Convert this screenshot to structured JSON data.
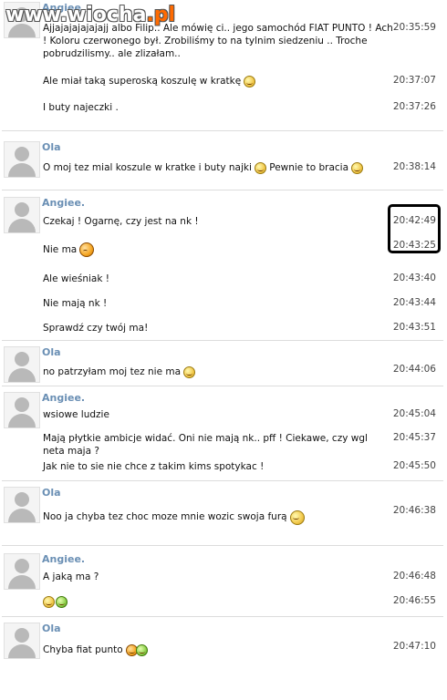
{
  "watermark": {
    "main": "www.wiocha",
    "suffix": ".pl"
  },
  "blocks": [
    {
      "sender": "Angiee.",
      "messages": [
        {
          "text": "Ajjajajajajajajj albo Filip.. Ale mówię ci.. jego samochód FIAT PUNTO ! Ach ! Koloru czerwonego był. Zrobiliśmy to na tylnim siedzeniu .. Troche pobrudzilismy.. ale zlizałam..",
          "time": "20:35:59"
        },
        {
          "text": "Ale miał taką superoską koszulę w kratkę",
          "time": "20:37:07",
          "emoticon": "big-grin-icon"
        },
        {
          "text": "I buty najeczki .",
          "time": "20:37:26"
        }
      ]
    },
    {
      "sender": "Ola",
      "messages": [
        {
          "text": "O moj tez mial koszule w kratke i buty najki",
          "text2": "Pewnie to bracia",
          "time": "20:38:14",
          "emoticon": "big-grin-icon",
          "emoticon2": "big-grin-icon"
        }
      ]
    },
    {
      "sender": "Angiee.",
      "messages": [
        {
          "text": "Czekaj ! Ogarnę, czy jest na nk !",
          "time": "20:42:49"
        },
        {
          "text": "Nie ma",
          "time": "20:43:25",
          "emoticon": "sad-face-icon"
        },
        {
          "text": "Ale wieśniak !",
          "time": "20:43:40"
        },
        {
          "text": "Nie mają nk !",
          "time": "20:43:44"
        },
        {
          "text": "Sprawdź czy twój ma!",
          "time": "20:43:51"
        }
      ]
    },
    {
      "sender": "Ola",
      "messages": [
        {
          "text": "no patrzyłam moj tez nie ma",
          "time": "20:44:06",
          "emoticon": "big-grin-icon"
        }
      ]
    },
    {
      "sender": "Angiee.",
      "messages": [
        {
          "text": "wsiowe ludzie",
          "time": "20:45:04"
        },
        {
          "text": "Mają płytkie ambicje widać. Oni nie mają nk.. pff ! Ciekawe, czy wgl neta maja ?",
          "time": "20:45:37"
        },
        {
          "text": "Jak nie to sie nie chce z takim kims spotykac !",
          "time": "20:45:50"
        }
      ]
    },
    {
      "sender": "Ola",
      "messages": [
        {
          "text": "Noo ja chyba tez choc moze mnie wozic swoja furą",
          "time": "20:46:38",
          "emoticon": "smile-icon"
        }
      ]
    },
    {
      "sender": "Angiee.",
      "messages": [
        {
          "text": "A jaką ma ?",
          "time": "20:46:48"
        },
        {
          "text": "",
          "time": "20:46:55",
          "emoticon": "grin-icon",
          "emoticon2": "green-face-icon"
        }
      ]
    },
    {
      "sender": "Ola",
      "messages": [
        {
          "text": "Chyba fiat punto",
          "time": "20:47:10",
          "emoticon": "orange-face-icon",
          "emoticon2": "green-face-icon"
        }
      ]
    }
  ]
}
